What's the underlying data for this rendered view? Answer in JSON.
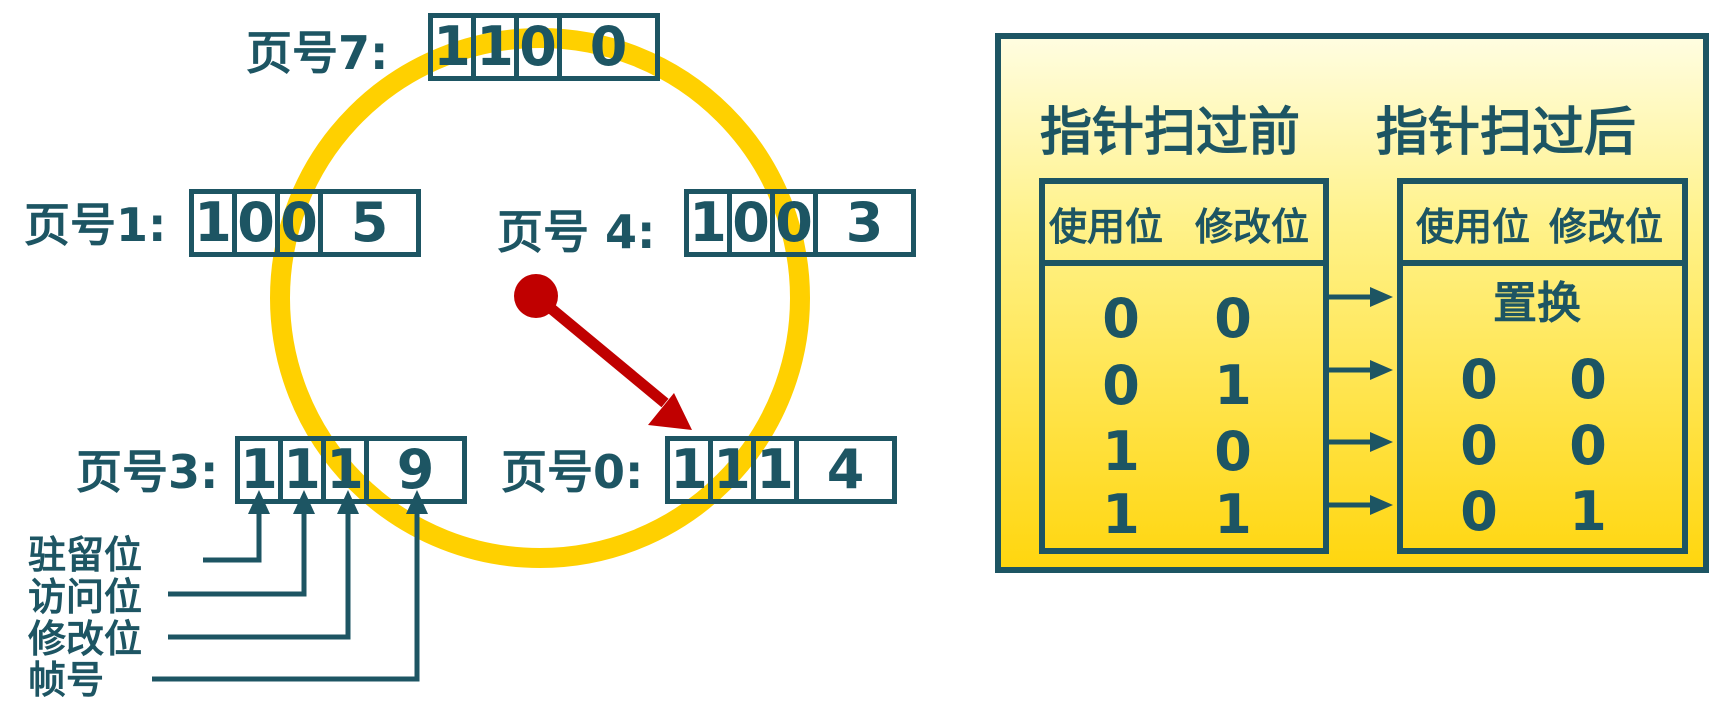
{
  "colors": {
    "primary": "#1d5563",
    "clock_ring": "#ffd000",
    "hand": "#c00000"
  },
  "pages": [
    {
      "id": "p7",
      "label": "页号7:",
      "bits": [
        "1",
        "1",
        "0"
      ],
      "frame": "0"
    },
    {
      "id": "p1",
      "label": "页号1:",
      "bits": [
        "1",
        "0",
        "0"
      ],
      "frame": "5"
    },
    {
      "id": "p4",
      "label": "页号 4:",
      "bits": [
        "1",
        "0",
        "0"
      ],
      "frame": "3"
    },
    {
      "id": "p3",
      "label": "页号3:",
      "bits": [
        "1",
        "1",
        "1"
      ],
      "frame": "9"
    },
    {
      "id": "p0",
      "label": "页号0:",
      "bits": [
        "1",
        "1",
        "1"
      ],
      "frame": "4"
    }
  ],
  "field_labels": [
    "驻留位",
    "访问位",
    "修改位",
    "帧号"
  ],
  "legend": {
    "before_title": "指针扫过前",
    "after_title": "指针扫过后",
    "before_headers": [
      "使用位",
      "修改位"
    ],
    "after_headers": [
      "使用位",
      "修改位"
    ],
    "before_rows": [
      [
        "0",
        "0"
      ],
      [
        "0",
        "1"
      ],
      [
        "1",
        "0"
      ],
      [
        "1",
        "1"
      ]
    ],
    "after_first": "置换",
    "after_rows": [
      [
        "0",
        "0"
      ],
      [
        "0",
        "0"
      ],
      [
        "0",
        "1"
      ]
    ]
  }
}
